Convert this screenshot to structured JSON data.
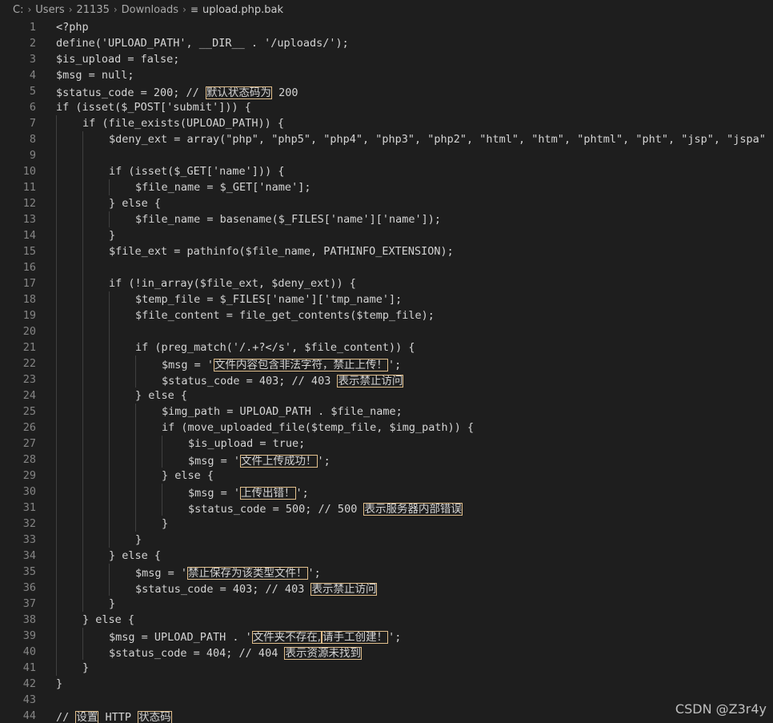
{
  "breadcrumb": [
    "C:",
    "Users",
    "21135",
    "Downloads",
    "upload.php.bak"
  ],
  "watermark": "CSDN @Z3r4y",
  "lines": [
    {
      "n": "1",
      "i": 0,
      "t": "<?php"
    },
    {
      "n": "2",
      "i": 0,
      "t": "define('UPLOAD_PATH', __DIR__ . '/uploads/');"
    },
    {
      "n": "3",
      "i": 0,
      "t": "$is_upload = false;"
    },
    {
      "n": "4",
      "i": 0,
      "t": "$msg = null;"
    },
    {
      "n": "5",
      "i": 0,
      "t": "$status_code = 200; // [[默认状态码为]] 200"
    },
    {
      "n": "6",
      "i": 0,
      "t": "if (isset($_POST['submit'])) {"
    },
    {
      "n": "7",
      "i": 1,
      "t": "if (file_exists(UPLOAD_PATH)) {"
    },
    {
      "n": "8",
      "i": 2,
      "t": "$deny_ext = array(\"php\", \"php5\", \"php4\", \"php3\", \"php2\", \"html\", \"htm\", \"phtml\", \"pht\", \"jsp\", \"jspa\""
    },
    {
      "n": "9",
      "i": 2,
      "t": ""
    },
    {
      "n": "10",
      "i": 2,
      "t": "if (isset($_GET['name'])) {"
    },
    {
      "n": "11",
      "i": 3,
      "t": "$file_name = $_GET['name'];"
    },
    {
      "n": "12",
      "i": 2,
      "t": "} else {"
    },
    {
      "n": "13",
      "i": 3,
      "t": "$file_name = basename($_FILES['name']['name']);"
    },
    {
      "n": "14",
      "i": 2,
      "t": "}"
    },
    {
      "n": "15",
      "i": 2,
      "t": "$file_ext = pathinfo($file_name, PATHINFO_EXTENSION);"
    },
    {
      "n": "16",
      "i": 2,
      "t": ""
    },
    {
      "n": "17",
      "i": 2,
      "t": "if (!in_array($file_ext, $deny_ext)) {"
    },
    {
      "n": "18",
      "i": 3,
      "t": "$temp_file = $_FILES['name']['tmp_name'];"
    },
    {
      "n": "19",
      "i": 3,
      "t": "$file_content = file_get_contents($temp_file);"
    },
    {
      "n": "20",
      "i": 3,
      "t": ""
    },
    {
      "n": "21",
      "i": 3,
      "t": "if (preg_match('/.+?</s', $file_content)) {"
    },
    {
      "n": "22",
      "i": 4,
      "t": "$msg = '[[文件内容包含非法字符，禁止上传！]]';"
    },
    {
      "n": "23",
      "i": 4,
      "t": "$status_code = 403; // 403 [[表示禁止访问]]"
    },
    {
      "n": "24",
      "i": 3,
      "t": "} else {"
    },
    {
      "n": "25",
      "i": 4,
      "t": "$img_path = UPLOAD_PATH . $file_name;"
    },
    {
      "n": "26",
      "i": 4,
      "t": "if (move_uploaded_file($temp_file, $img_path)) {"
    },
    {
      "n": "27",
      "i": 5,
      "t": "$is_upload = true;"
    },
    {
      "n": "28",
      "i": 5,
      "t": "$msg = '[[文件上传成功！]]';"
    },
    {
      "n": "29",
      "i": 4,
      "t": "} else {"
    },
    {
      "n": "30",
      "i": 5,
      "t": "$msg = '[[上传出错！]]';"
    },
    {
      "n": "31",
      "i": 5,
      "t": "$status_code = 500; // 500 [[表示服务器内部错误]]"
    },
    {
      "n": "32",
      "i": 4,
      "t": "}"
    },
    {
      "n": "33",
      "i": 3,
      "t": "}"
    },
    {
      "n": "34",
      "i": 2,
      "t": "} else {"
    },
    {
      "n": "35",
      "i": 3,
      "t": "$msg = '[[禁止保存为该类型文件！]]';"
    },
    {
      "n": "36",
      "i": 3,
      "t": "$status_code = 403; // 403 [[表示禁止访问]]"
    },
    {
      "n": "37",
      "i": 2,
      "t": "}"
    },
    {
      "n": "38",
      "i": 1,
      "t": "} else {"
    },
    {
      "n": "39",
      "i": 2,
      "t": "$msg = UPLOAD_PATH . '[[文件夹不存在,]][[请手工创建！]]';"
    },
    {
      "n": "40",
      "i": 2,
      "t": "$status_code = 404; // 404 [[表示资源未找到]]"
    },
    {
      "n": "41",
      "i": 1,
      "t": "}"
    },
    {
      "n": "42",
      "i": 0,
      "t": "}"
    },
    {
      "n": "43",
      "i": 0,
      "t": ""
    },
    {
      "n": "44",
      "i": 0,
      "t": "// [[设置]] HTTP [[状态码]]"
    }
  ]
}
